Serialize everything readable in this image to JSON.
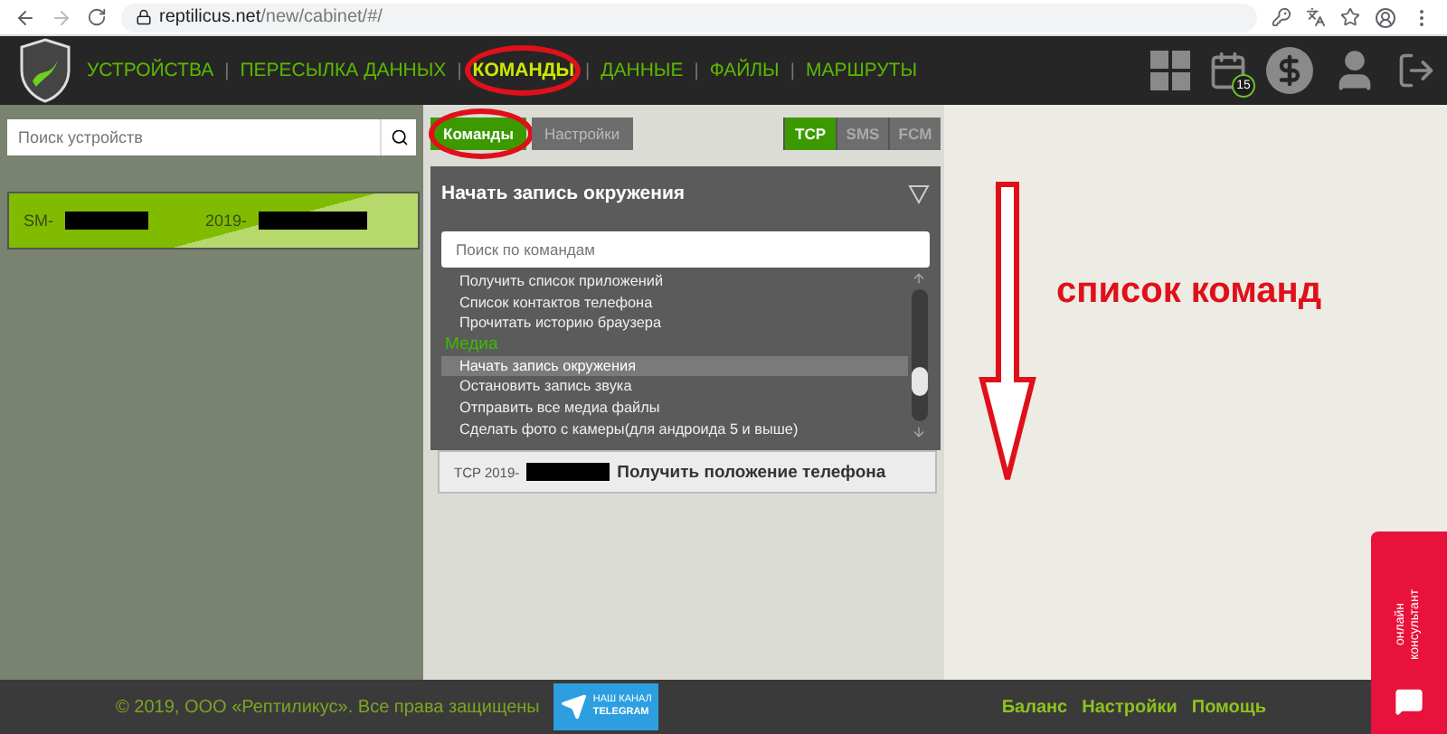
{
  "browser": {
    "url_host": "reptilicus.net",
    "url_path": "/new/cabinet/#/"
  },
  "header": {
    "nav": [
      {
        "label": "УСТРОЙСТВА",
        "selected": false,
        "circled": false
      },
      {
        "label": "ПЕРЕСЫЛКА ДАННЫХ",
        "selected": false,
        "circled": false
      },
      {
        "label": "КОМАНДЫ",
        "selected": true,
        "circled": true
      },
      {
        "label": "ДАННЫЕ",
        "selected": false,
        "circled": false
      },
      {
        "label": "ФАЙЛЫ",
        "selected": false,
        "circled": false
      },
      {
        "label": "МАРШРУТЫ",
        "selected": false,
        "circled": false
      }
    ],
    "separator": "|",
    "calendar_badge": "15"
  },
  "device_search": {
    "placeholder": "Поиск устройств"
  },
  "devices": [
    {
      "model": "SM-",
      "date": "2019-",
      "selected": true
    }
  ],
  "command_tabs": [
    {
      "label": "Команды",
      "selected": true,
      "circled": true
    },
    {
      "label": "Настройки",
      "selected": false,
      "circled": false
    }
  ],
  "channels": [
    {
      "label": "TCP",
      "selected": true
    },
    {
      "label": "SMS",
      "selected": false
    },
    {
      "label": "FCM",
      "selected": false
    }
  ],
  "command_panel": {
    "title": "Начать запись окружения",
    "search_placeholder": "Поиск по командам",
    "items": [
      {
        "kind": "command",
        "label": "Получить список приложений",
        "selected": false
      },
      {
        "kind": "command",
        "label": "Список контактов телефона",
        "selected": false
      },
      {
        "kind": "command",
        "label": "Прочитать историю браузера",
        "selected": false
      },
      {
        "kind": "group",
        "label": "Медиа"
      },
      {
        "kind": "command",
        "label": "Начать запись окружения",
        "selected": true
      },
      {
        "kind": "command",
        "label": "Остановить запись звука",
        "selected": false
      },
      {
        "kind": "command",
        "label": "Отправить все медиа файлы",
        "selected": false
      },
      {
        "kind": "command",
        "label": "Сделать фото с камеры(для андроида 5 и выше)",
        "selected": false
      }
    ]
  },
  "history": [
    {
      "prefix": "TCP 2019-",
      "command": "Получить положение телефона"
    }
  ],
  "annotation": {
    "text": "список команд"
  },
  "footer": {
    "copyright": "© 2019, ООО «Рептиликус». Все права защищены",
    "telegram": [
      "НАШ КАНАЛ",
      "TELEGRAM"
    ],
    "links": [
      "Баланс",
      "Настройки",
      "Помощь"
    ]
  },
  "consultant": {
    "label": "онлайн консультант"
  }
}
